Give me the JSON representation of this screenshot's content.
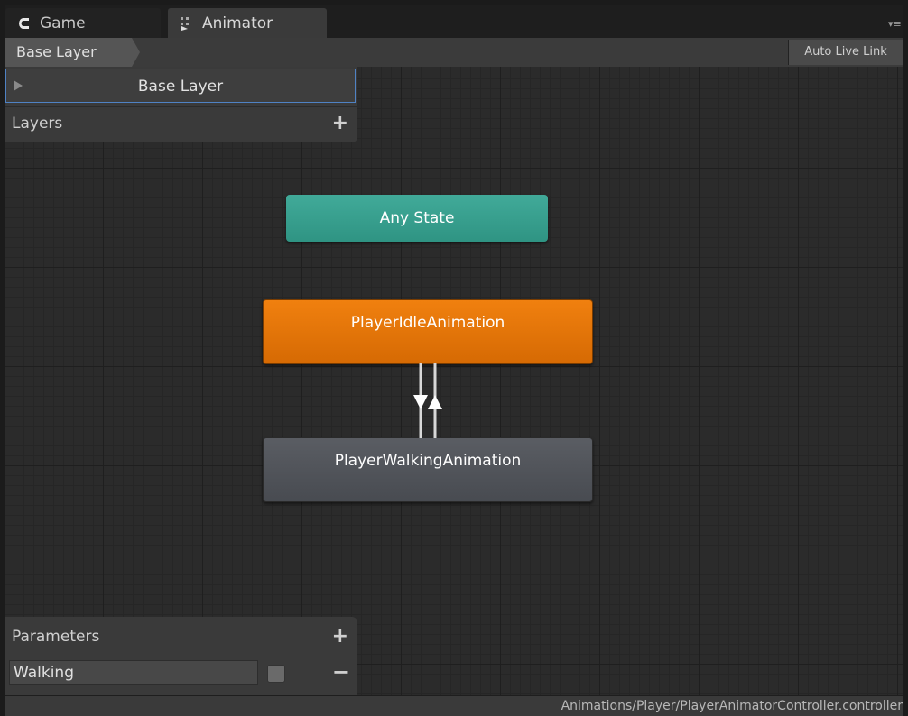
{
  "tabs": [
    {
      "label": "Game",
      "icon": "unity-logo-icon"
    },
    {
      "label": "Animator",
      "icon": "animator-icon"
    }
  ],
  "breadcrumb": {
    "label": "Base Layer"
  },
  "toolbar": {
    "auto_live_link": "Auto Live Link"
  },
  "layers": {
    "header": "Layers",
    "add_label": "+",
    "items": [
      {
        "name": "Base Layer"
      }
    ]
  },
  "states": {
    "any": "Any State",
    "idle": "PlayerIdleAnimation",
    "walking": "PlayerWalkingAnimation"
  },
  "colors": {
    "any_state": "#36a08f",
    "default_state": "#e77708",
    "state": "#4f5258",
    "selection": "#4f82c4"
  },
  "parameters": {
    "header": "Parameters",
    "add_label": "+",
    "items": [
      {
        "name": "Walking",
        "checked": false,
        "remove_label": "−"
      }
    ]
  },
  "status": {
    "path": "Animations/Player/PlayerAnimatorController.controller"
  }
}
